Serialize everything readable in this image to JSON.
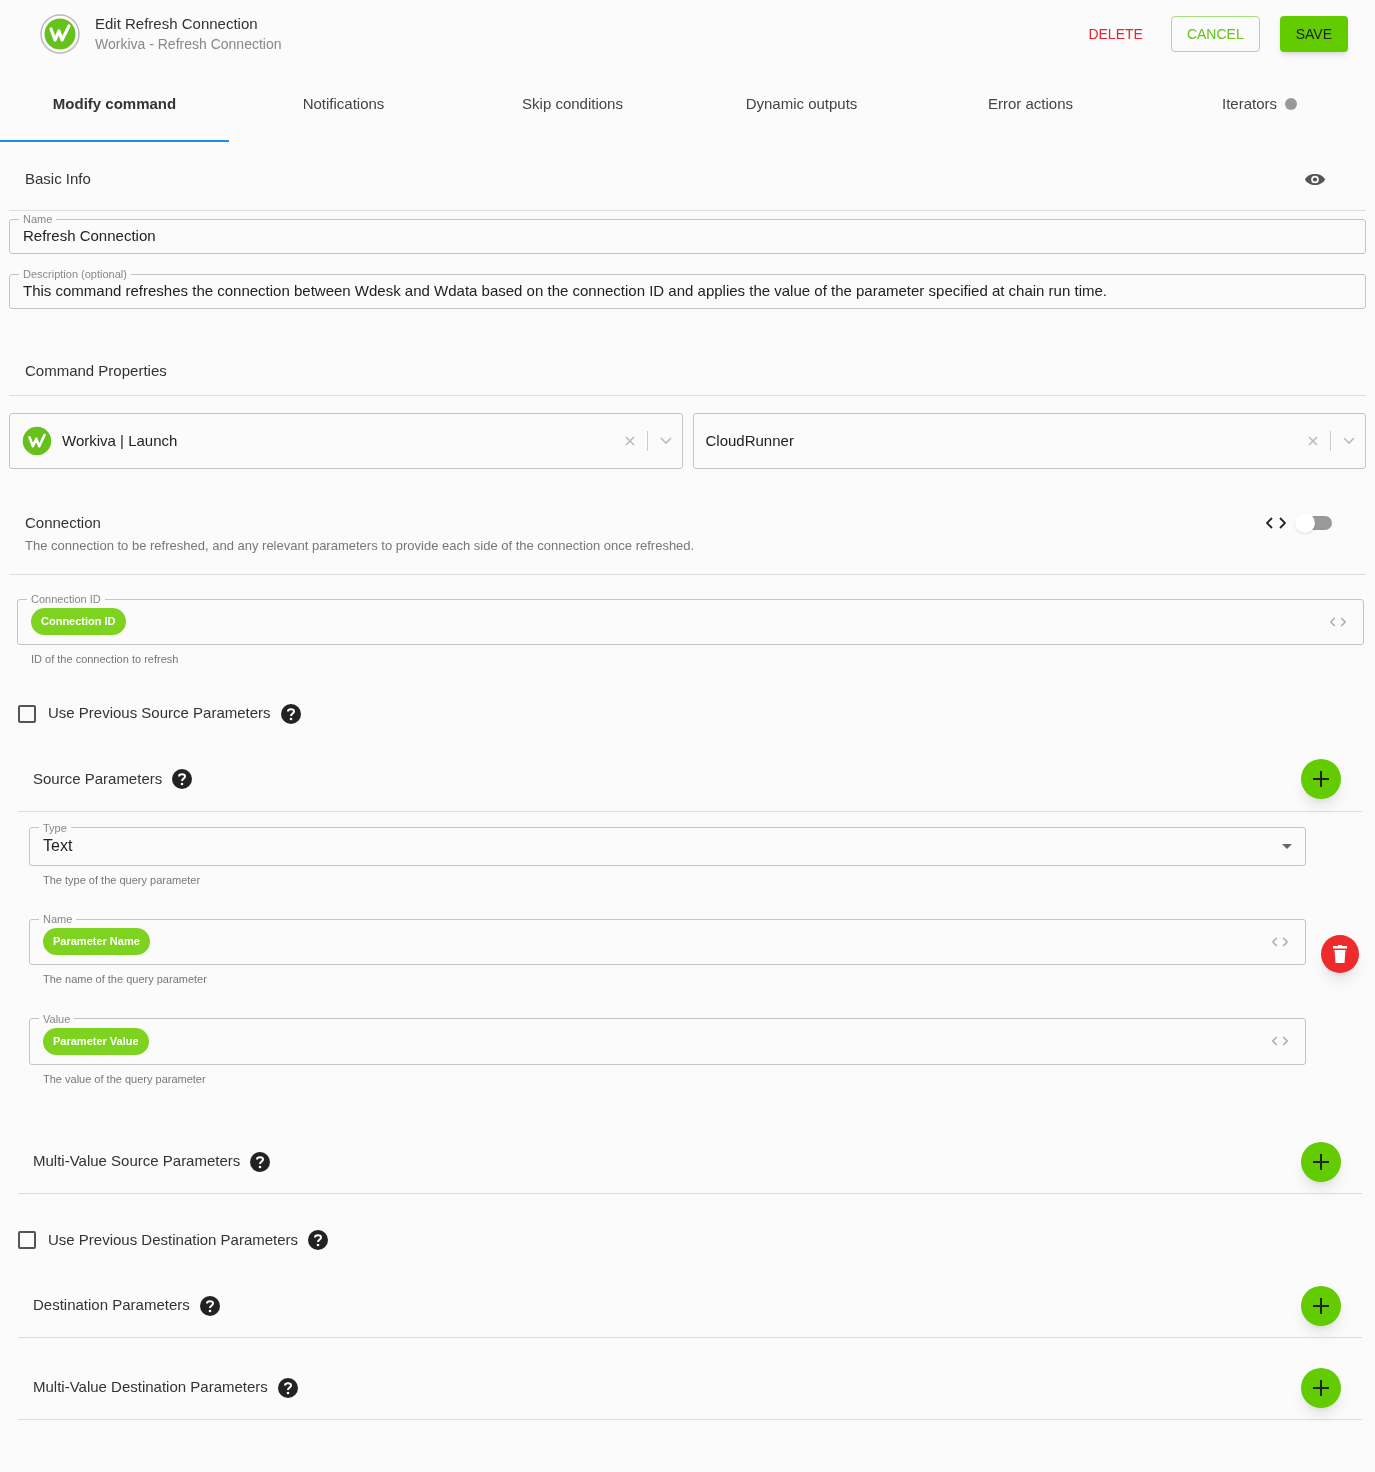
{
  "header": {
    "title": "Edit Refresh Connection",
    "subtitle": "Workiva - Refresh Connection",
    "buttons": [
      {
        "label": "DELETE",
        "kind": "delete"
      },
      {
        "label": "CANCEL",
        "kind": "cancel"
      },
      {
        "label": "SAVE",
        "kind": "save"
      }
    ]
  },
  "tabs": [
    {
      "label": "Modify command",
      "selected": true,
      "dot": false
    },
    {
      "label": "Notifications",
      "selected": false,
      "dot": false
    },
    {
      "label": "Skip conditions",
      "selected": false,
      "dot": false
    },
    {
      "label": "Dynamic outputs",
      "selected": false,
      "dot": false
    },
    {
      "label": "Error actions",
      "selected": false,
      "dot": false
    },
    {
      "label": "Iterators",
      "selected": false,
      "dot": true
    }
  ],
  "basic_info": {
    "title": "Basic Info",
    "name_field": {
      "label": "Name",
      "value": "Refresh Connection"
    },
    "description_field": {
      "label": "Description (optional)",
      "value": "This command refreshes the connection between Wdesk and Wdata based on the connection ID and applies the value of the parameter specified at chain run time."
    }
  },
  "command_properties": {
    "title": "Command Properties",
    "selects": [
      {
        "value": "Workiva | Launch",
        "logo": true
      },
      {
        "value": "CloudRunner",
        "logo": false
      }
    ]
  },
  "connection": {
    "title": "Connection",
    "description": "The connection to be refreshed, and any relevant parameters to provide each side of the connection once refreshed.",
    "toggle_on": false,
    "connection_id": {
      "label": "Connection ID",
      "chip": "Connection ID",
      "hint": "ID of the connection to refresh"
    }
  },
  "rows": [
    {
      "kind": "checkbox",
      "label": "Use Previous Source Parameters",
      "checked": false
    },
    {
      "kind": "group",
      "title": "Source Parameters",
      "fields": [
        {
          "kind": "select",
          "label": "Type",
          "value": "Text",
          "hint": "The type of the query parameter"
        },
        {
          "kind": "chip",
          "label": "Name",
          "chip": "Parameter Name",
          "hint": "The name of the query parameter"
        },
        {
          "kind": "chip",
          "label": "Value",
          "chip": "Parameter Value",
          "hint": "The value of the query parameter"
        }
      ]
    },
    {
      "kind": "group",
      "title": "Multi-Value Source Parameters"
    },
    {
      "kind": "checkbox",
      "label": "Use Previous Destination Parameters",
      "checked": false
    },
    {
      "kind": "group",
      "title": "Destination Parameters"
    },
    {
      "kind": "group",
      "title": "Multi-Value Destination Parameters"
    }
  ]
}
